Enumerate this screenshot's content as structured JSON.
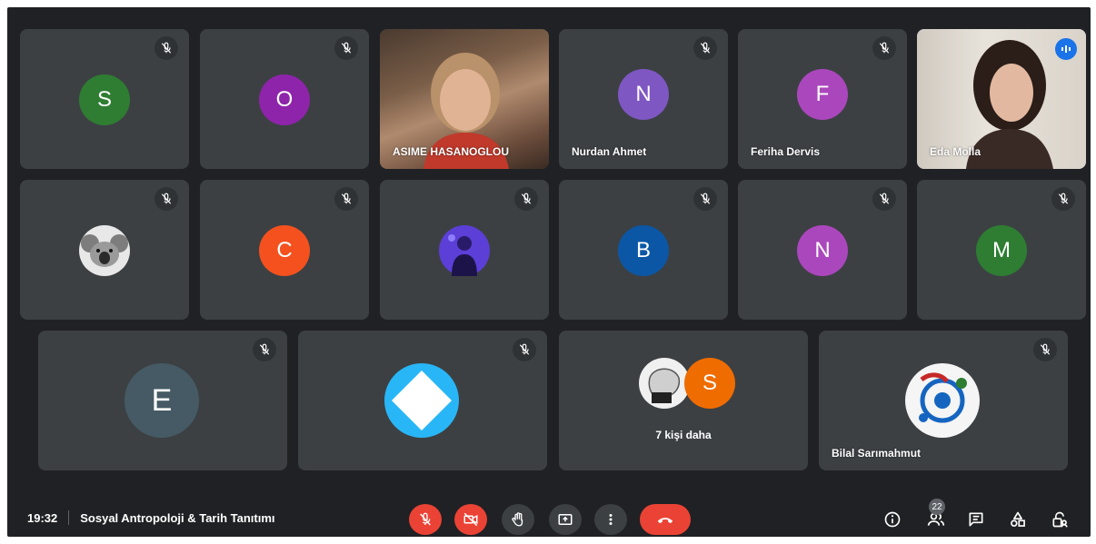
{
  "tiles": [
    {
      "initial": "S",
      "color": "#2e7d32"
    },
    {
      "initial": "O",
      "color": "#8e24aa"
    },
    {
      "name": "ASIME HASANOGLOU"
    },
    {
      "initial": "N",
      "color": "#7e57c2",
      "name": "Nurdan Ahmet"
    },
    {
      "initial": "F",
      "color": "#ab47bc",
      "name": "Feriha Dervis"
    },
    {
      "name": "Eda Molla"
    },
    {
      "avatar_icon": "koala-photo-avatar"
    },
    {
      "initial": "C",
      "color": "#f4511e"
    },
    {
      "avatar_icon": "purple-photo-avatar"
    },
    {
      "initial": "B",
      "color": "#0b57a5"
    },
    {
      "initial": "N",
      "color": "#ab47bc"
    },
    {
      "initial": "M",
      "color": "#2e7d32"
    },
    {
      "initial": "E",
      "color": "#455a64"
    },
    {
      "avatar_icon": "blue-diamond-avatar"
    },
    {
      "initial": "S",
      "color": "#ef6c00",
      "more_label": "7 kişi daha"
    },
    {
      "name": "Bilal Sarımahmut",
      "avatar_icon": "tile-pattern-avatar"
    }
  ],
  "bottom_bar": {
    "time": "19:32",
    "meeting_title": "Sosyal Antropoloji & Tarih Tanıtımı",
    "participant_count": "22"
  },
  "colors": {
    "background": "#202124",
    "tile": "#3c4043",
    "danger": "#ea4335",
    "speaking_border": "#8ab4f8"
  }
}
